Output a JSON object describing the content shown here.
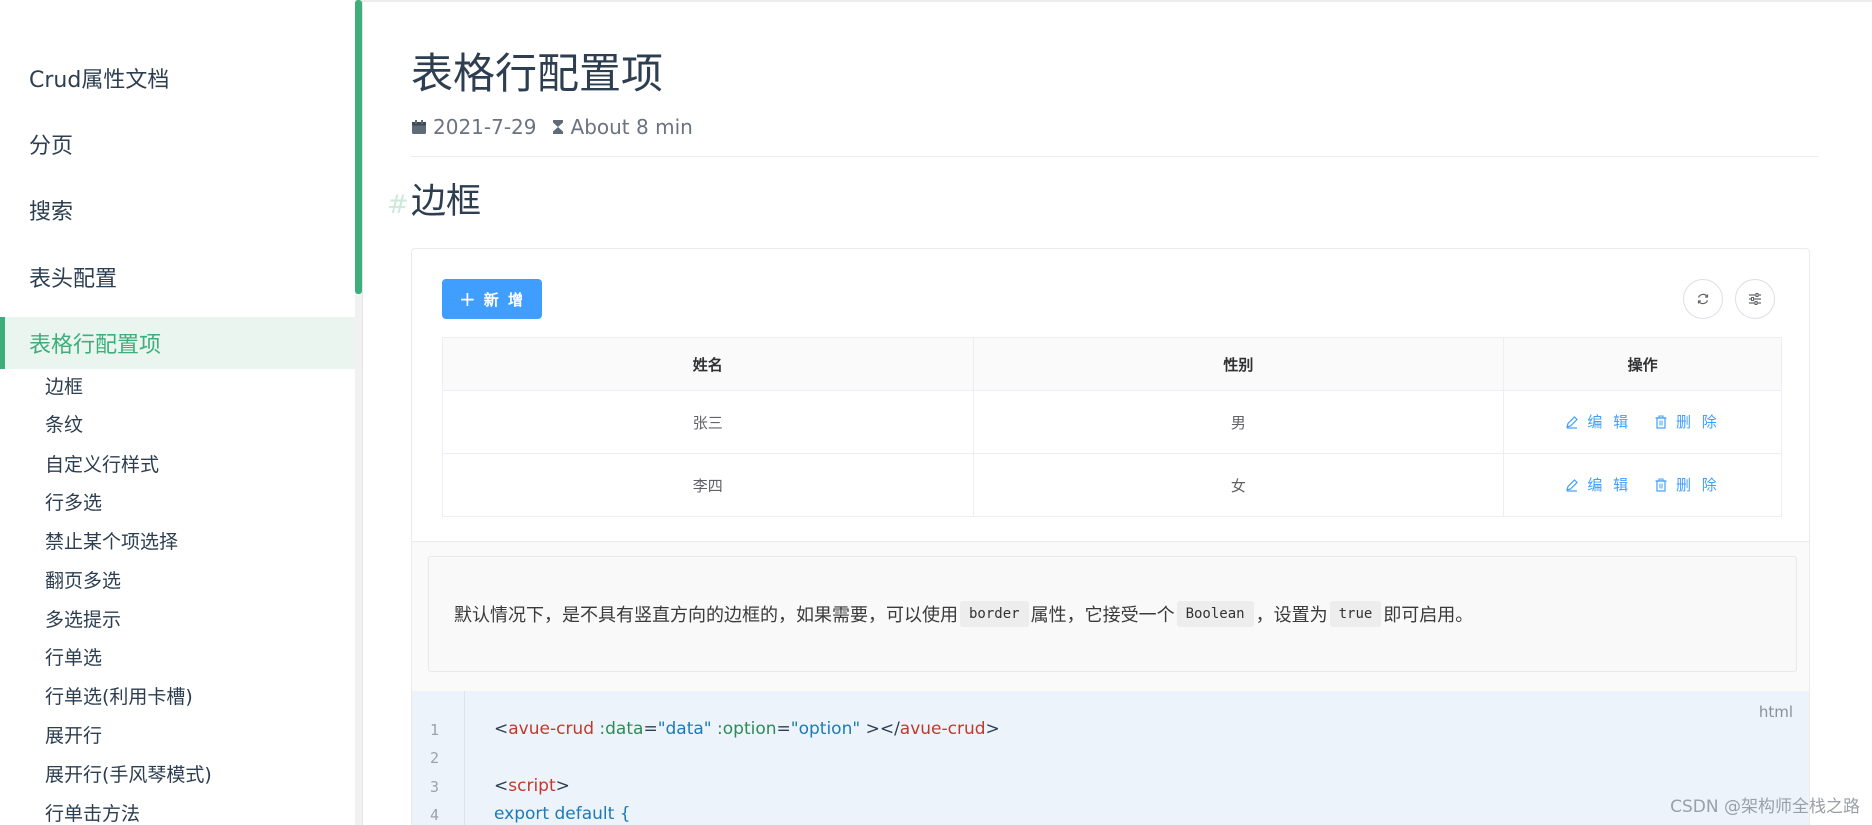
{
  "sidebar": {
    "top_items": [
      "Crud属性文档",
      "分页",
      "搜索",
      "表头配置"
    ],
    "active_item": "表格行配置项",
    "sub_items": [
      "边框",
      "条纹",
      "自定义行样式",
      "行多选",
      "禁止某个项选择",
      "翻页多选",
      "多选提示",
      "行单选",
      "行单选(利用卡槽)",
      "展开行",
      "展开行(手风琴模式)",
      "行单击方法"
    ]
  },
  "page": {
    "title": "表格行配置项",
    "date": "2021-7-29",
    "read_time": "About 8 min",
    "section_hash": "#",
    "section_title": "边框"
  },
  "demo": {
    "add_button": "新 增",
    "add_icon": "plus-icon",
    "refresh_icon": "refresh-icon",
    "settings_icon": "sliders-icon",
    "columns": [
      "姓名",
      "性别",
      "操作"
    ],
    "rows": [
      {
        "name": "张三",
        "gender": "男"
      },
      {
        "name": "李四",
        "gender": "女"
      }
    ],
    "edit_label": "编 辑",
    "delete_label": "删 除",
    "edit_icon": "edit-icon",
    "delete_icon": "trash-icon"
  },
  "description": {
    "p1": "默认情况下，是不具有竖直方向的边框的，如果需要，可以使用",
    "code1": "border",
    "p2": "属性，它接受一个",
    "code2": "Boolean",
    "p3": "，设置为",
    "code3": "true",
    "p4": "即可启用。"
  },
  "code": {
    "lang": "html",
    "line_numbers": [
      "1",
      "2",
      "3",
      "4"
    ],
    "line1": {
      "t1": "<",
      "tag": "avue-crud",
      "a1": " :data",
      "eq1": "=",
      "s1": "\"data\"",
      "a2": " :option",
      "eq2": "=",
      "s2": "\"option\"",
      "t2": " ></",
      "tag2": "avue-crud",
      "t3": ">"
    },
    "line3": {
      "t1": "<",
      "tag": "script",
      "t2": ">"
    },
    "line4": "export default {"
  },
  "watermark": "CSDN @架构师全栈之路",
  "colors": {
    "accent": "#3eaf7c",
    "primary": "#409eff"
  }
}
